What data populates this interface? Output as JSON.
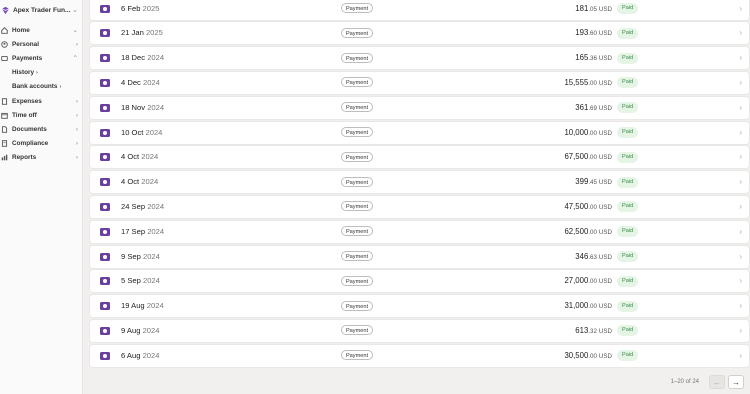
{
  "sidebar": {
    "workspace": "Apex Trader Fun...",
    "items": [
      {
        "label": "Home",
        "icon": "home-icon"
      },
      {
        "label": "Personal",
        "icon": "person-icon"
      },
      {
        "label": "Payments",
        "icon": "payments-icon"
      },
      {
        "label": "Expenses",
        "icon": "expenses-icon"
      },
      {
        "label": "Time off",
        "icon": "calendar-icon"
      },
      {
        "label": "Documents",
        "icon": "document-icon"
      },
      {
        "label": "Compliance",
        "icon": "compliance-icon"
      },
      {
        "label": "Reports",
        "icon": "chart-icon"
      }
    ],
    "payments_sub": [
      {
        "label": "History"
      },
      {
        "label": "Bank accounts"
      }
    ]
  },
  "payments": [
    {
      "day": "6 Feb",
      "year": "2025",
      "type": "Payment",
      "amount": "181",
      "cents": ".05",
      "currency": "USD",
      "status": "Paid"
    },
    {
      "day": "21 Jan",
      "year": "2025",
      "type": "Payment",
      "amount": "193",
      "cents": ".60",
      "currency": "USD",
      "status": "Paid"
    },
    {
      "day": "18 Dec",
      "year": "2024",
      "type": "Payment",
      "amount": "165",
      "cents": ".36",
      "currency": "USD",
      "status": "Paid"
    },
    {
      "day": "4 Dec",
      "year": "2024",
      "type": "Payment",
      "amount": "15,555",
      "cents": ".00",
      "currency": "USD",
      "status": "Paid"
    },
    {
      "day": "18 Nov",
      "year": "2024",
      "type": "Payment",
      "amount": "361",
      "cents": ".69",
      "currency": "USD",
      "status": "Paid"
    },
    {
      "day": "10 Oct",
      "year": "2024",
      "type": "Payment",
      "amount": "10,000",
      "cents": ".00",
      "currency": "USD",
      "status": "Paid"
    },
    {
      "day": "4 Oct",
      "year": "2024",
      "type": "Payment",
      "amount": "67,500",
      "cents": ".00",
      "currency": "USD",
      "status": "Paid"
    },
    {
      "day": "4 Oct",
      "year": "2024",
      "type": "Payment",
      "amount": "399",
      "cents": ".45",
      "currency": "USD",
      "status": "Paid"
    },
    {
      "day": "24 Sep",
      "year": "2024",
      "type": "Payment",
      "amount": "47,500",
      "cents": ".00",
      "currency": "USD",
      "status": "Paid"
    },
    {
      "day": "17 Sep",
      "year": "2024",
      "type": "Payment",
      "amount": "62,500",
      "cents": ".00",
      "currency": "USD",
      "status": "Paid"
    },
    {
      "day": "9 Sep",
      "year": "2024",
      "type": "Payment",
      "amount": "346",
      "cents": ".63",
      "currency": "USD",
      "status": "Paid"
    },
    {
      "day": "5 Sep",
      "year": "2024",
      "type": "Payment",
      "amount": "27,000",
      "cents": ".00",
      "currency": "USD",
      "status": "Paid"
    },
    {
      "day": "19 Aug",
      "year": "2024",
      "type": "Payment",
      "amount": "31,000",
      "cents": ".00",
      "currency": "USD",
      "status": "Paid"
    },
    {
      "day": "9 Aug",
      "year": "2024",
      "type": "Payment",
      "amount": "613",
      "cents": ".32",
      "currency": "USD",
      "status": "Paid"
    },
    {
      "day": "6 Aug",
      "year": "2024",
      "type": "Payment",
      "amount": "30,500",
      "cents": ".00",
      "currency": "USD",
      "status": "Paid"
    }
  ],
  "pagination": {
    "text": "1–20 of 24",
    "prev": "←",
    "next": "→"
  },
  "colors": {
    "brand": "#6b3fa0",
    "paid_bg": "#e4f4e5",
    "paid_text": "#3b8c47",
    "page_bg": "#f1f0ee"
  }
}
